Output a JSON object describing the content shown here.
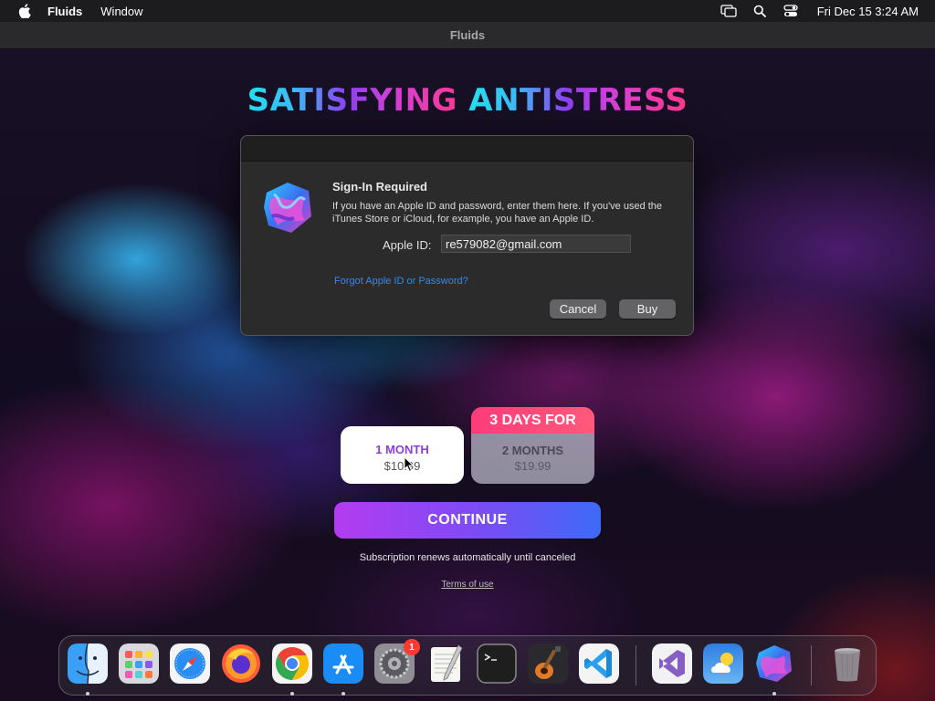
{
  "menubar": {
    "app_name": "Fluids",
    "menus": [
      "Window"
    ],
    "clock": "Fri Dec 15  3:24 AM",
    "status_icons": [
      "screen-mirroring-icon",
      "search-icon",
      "control-center-icon"
    ]
  },
  "window": {
    "title": "Fluids"
  },
  "headline": {
    "part1": "SATISFYING ",
    "part2": "ANTISTRESS"
  },
  "dialog": {
    "title": "Sign-In Required",
    "message": "If you have an Apple ID and password, enter them here. If you've used the iTunes Store or iCloud, for example, you have an Apple ID.",
    "apple_id_label": "Apple ID:",
    "apple_id_value": "re579082@gmail.com",
    "forgot_link": "Forgot Apple ID or Password?",
    "cancel_label": "Cancel",
    "buy_label": "Buy"
  },
  "plans": [
    {
      "name": "1 MONTH",
      "price": "$10.99",
      "selected": true
    },
    {
      "badge": "3 DAYS FOR",
      "name": "2 MONTHS",
      "price": "$19.99",
      "selected": false
    }
  ],
  "continue_label": "CONTINUE",
  "renew_note": "Subscription renews automatically until canceled",
  "terms_link": "Terms of use",
  "dock": {
    "apps": [
      "Finder",
      "Launchpad",
      "Safari",
      "Firefox",
      "Chrome",
      "App Store",
      "System Settings",
      "TextEdit",
      "Terminal",
      "GarageBand",
      "VS Code",
      "Visual Studio",
      "Weather",
      "Fluids",
      "Trash"
    ],
    "badge_count": "1"
  },
  "colors": {
    "accent_blue": "#2d8cf0",
    "continue_gradient": [
      "#b43cf0",
      "#3d6af6"
    ],
    "badge_pink": "#ff3b7a",
    "plan_selected_text": "#8a3fd6"
  }
}
